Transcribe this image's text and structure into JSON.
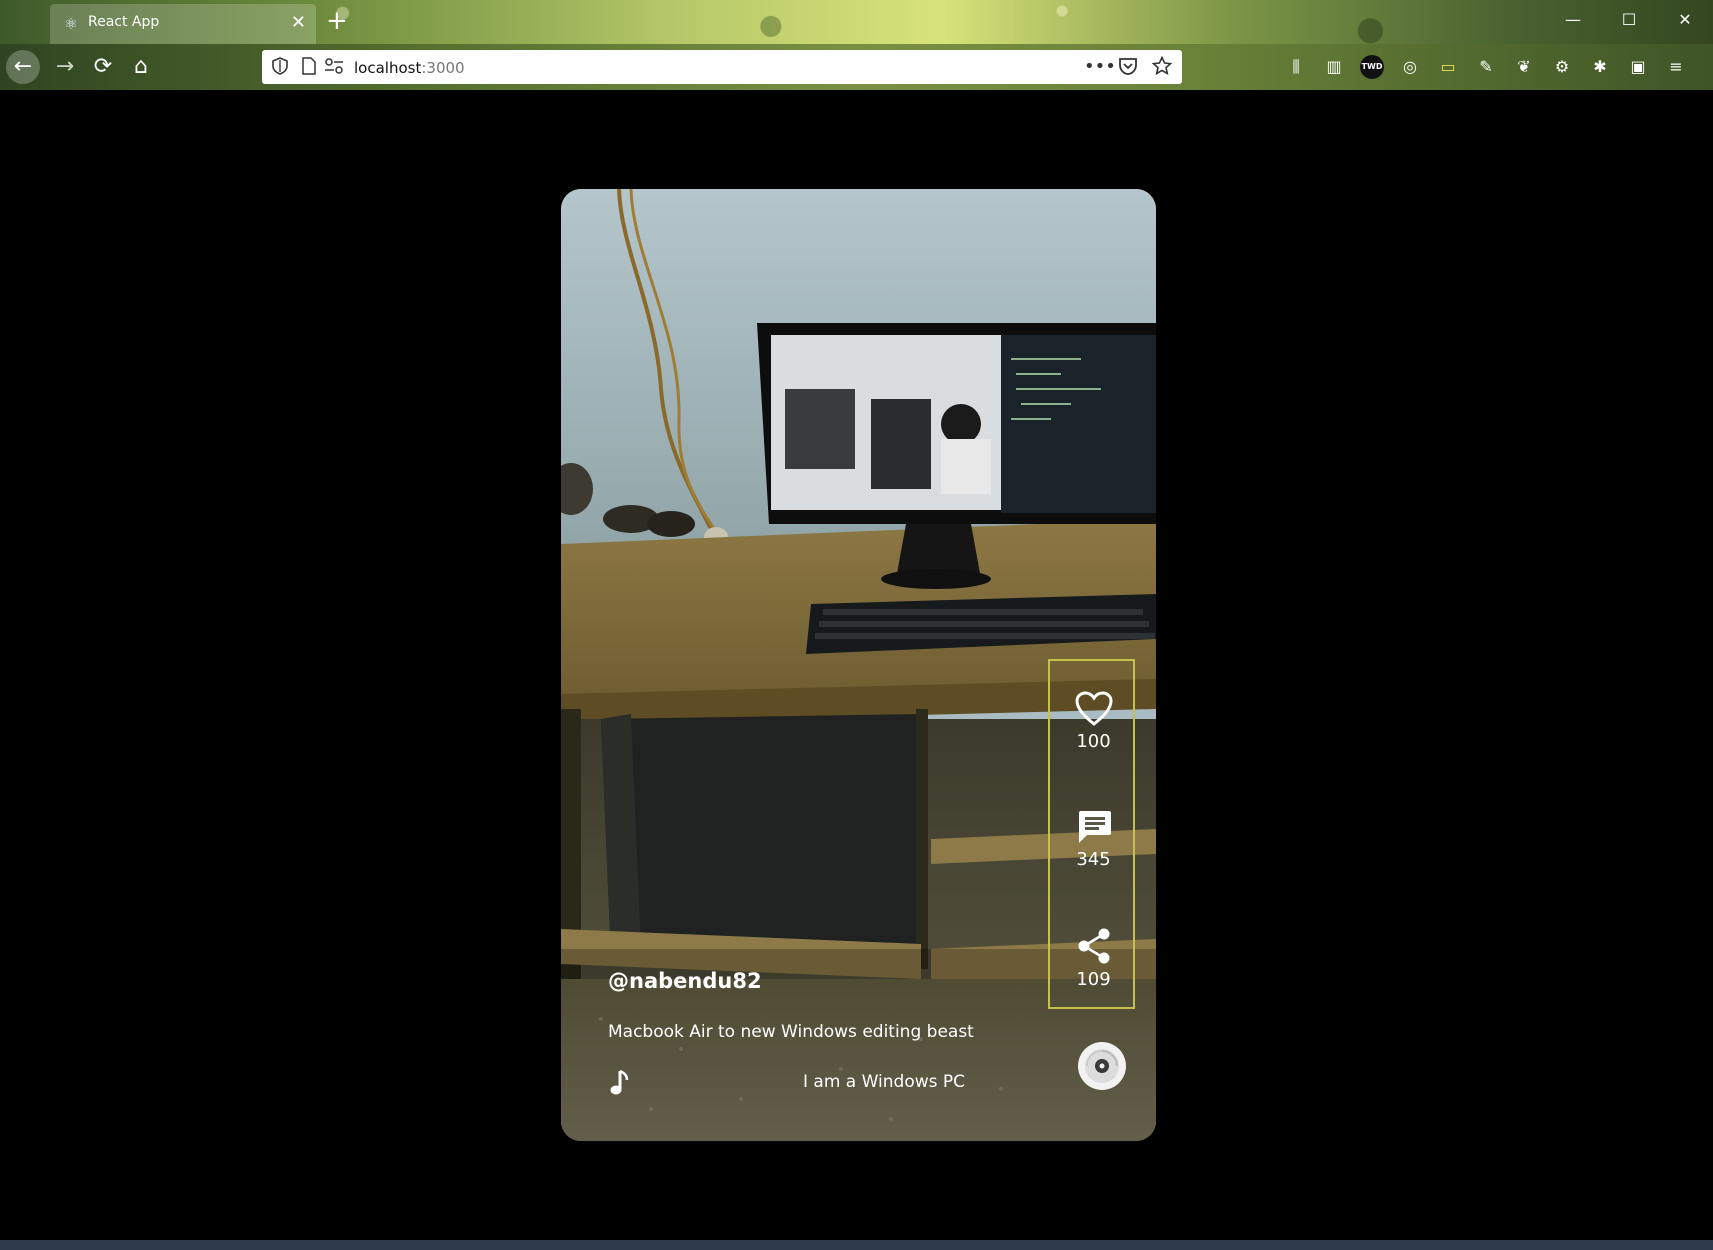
{
  "browser": {
    "tab_title": "React App",
    "tab_close": "✕",
    "new_tab": "+",
    "url_host": "localhost",
    "url_port": ":3000",
    "window_controls": [
      "—",
      "☐",
      "✕"
    ]
  },
  "nav": {
    "back_icon": "←",
    "forward_icon": "→",
    "reload_icon": "⟳",
    "home_icon": "⌂"
  },
  "video": {
    "username": "@nabendu82",
    "description": "Macbook Air to new Windows editing beast",
    "song": "I am a Windows PC",
    "likes": "100",
    "comments": "345",
    "shares": "109"
  },
  "colors": {
    "sidebar_border": "#c6c14a",
    "page_background": "#000000"
  }
}
